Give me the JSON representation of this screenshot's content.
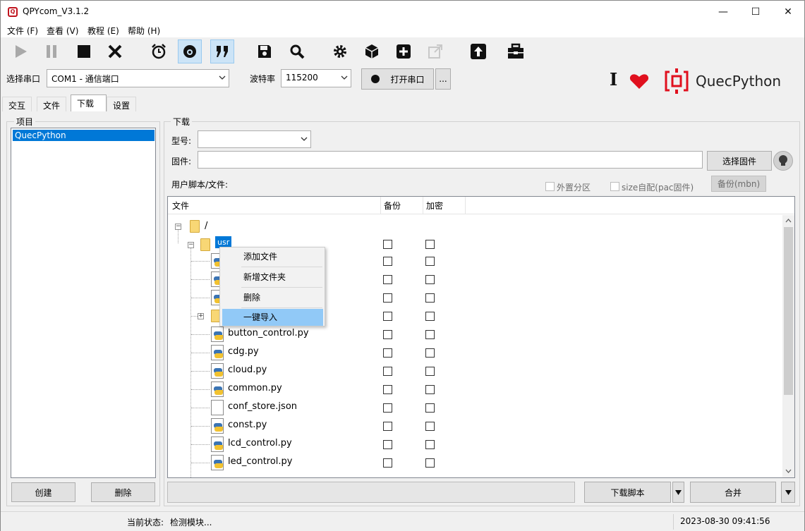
{
  "window": {
    "title": "QPYcom_V3.1.2",
    "minimize": "—",
    "maximize": "☐",
    "close": "✕"
  },
  "menu": [
    "文件 (F)",
    "查看 (V)",
    "教程 (E)",
    "帮助 (H)"
  ],
  "port": {
    "label": "选择串口",
    "value": "COM1 - 通信端口",
    "baud_label": "波特率",
    "baud_value": "115200",
    "open_button": "打开串口",
    "more_button": "..."
  },
  "brand": {
    "cursor_glyph": "I",
    "logo_text": "QuecPython",
    "accent": "#e0101e"
  },
  "tabs": [
    "交互",
    "文件",
    "下载",
    "设置"
  ],
  "selected_tab": "下载",
  "project": {
    "group_label": "项目",
    "items": [
      "QuecPython"
    ],
    "create_button": "创建",
    "delete_button": "删除"
  },
  "download": {
    "group_label": "下载",
    "model_label": "型号:",
    "model_value": "",
    "firmware_label": "固件:",
    "firmware_value": "",
    "select_firmware_button": "选择固件",
    "user_script_label": "用户脚本/文件:",
    "external_partition_label": "外置分区",
    "size_auto_label": "size自配(pac固件)",
    "backup_button": "备份(mbn)",
    "columns": [
      "文件",
      "备份",
      "加密"
    ],
    "root_label": "/",
    "usr_label": "usr",
    "files": [
      {
        "name": "",
        "type": "py"
      },
      {
        "name": "",
        "type": "py"
      },
      {
        "name": "",
        "type": "py"
      },
      {
        "name": "",
        "type": "folder"
      },
      {
        "name": "button_control.py",
        "type": "py"
      },
      {
        "name": "cdg.py",
        "type": "py"
      },
      {
        "name": "cloud.py",
        "type": "py"
      },
      {
        "name": "common.py",
        "type": "py"
      },
      {
        "name": "conf_store.json",
        "type": "json"
      },
      {
        "name": "const.py",
        "type": "py"
      },
      {
        "name": "lcd_control.py",
        "type": "py"
      },
      {
        "name": "led_control.py",
        "type": "py"
      }
    ],
    "download_script_button": "下载脚本",
    "merge_button": "合并",
    "progress_text": ""
  },
  "context_menu": {
    "items": [
      "添加文件",
      "新增文件夹",
      "删除",
      "一键导入"
    ],
    "highlighted": "一键导入"
  },
  "status": {
    "label": "当前状态:",
    "value": "检测模块...",
    "timestamp": "2023-08-30 09:41:56"
  }
}
